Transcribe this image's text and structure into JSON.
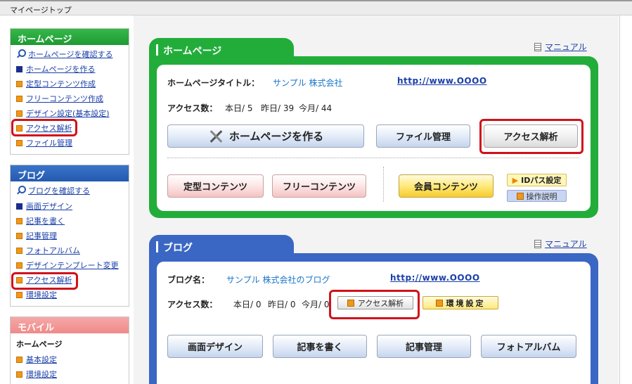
{
  "topbar": {
    "title": "マイページトップ"
  },
  "sidebar": {
    "homepage": {
      "title": "ホームページ",
      "items": [
        {
          "label": "ホームページを確認する",
          "icon": "magnifier-icon"
        },
        {
          "label": "ホームページを作る",
          "icon": "navy-square-icon"
        },
        {
          "label": "定型コンテンツ作成",
          "icon": "orange-square-icon"
        },
        {
          "label": "フリーコンテンツ作成",
          "icon": "orange-square-icon"
        },
        {
          "label": "デザイン設定(基本設定)",
          "icon": "orange-square-icon"
        },
        {
          "label": "アクセス解析",
          "icon": "orange-square-icon"
        },
        {
          "label": "ファイル管理",
          "icon": "orange-square-icon"
        }
      ]
    },
    "blog": {
      "title": "ブログ",
      "items": [
        {
          "label": "ブログを確認する",
          "icon": "magnifier-icon"
        },
        {
          "label": "画面デザイン",
          "icon": "navy-square-icon"
        },
        {
          "label": "記事を書く",
          "icon": "orange-square-icon"
        },
        {
          "label": "記事管理",
          "icon": "orange-square-icon"
        },
        {
          "label": "フォトアルバム",
          "icon": "orange-square-icon"
        },
        {
          "label": "デザインテンプレート変更",
          "icon": "orange-square-icon"
        },
        {
          "label": "アクセス解析",
          "icon": "orange-square-icon"
        },
        {
          "label": "環境設定",
          "icon": "orange-square-icon"
        }
      ]
    },
    "mobile": {
      "title": "モバイル",
      "subtitle": "ホームページ",
      "items": [
        {
          "label": "基本設定",
          "icon": "orange-square-icon"
        },
        {
          "label": "環境設定",
          "icon": "orange-square-icon"
        }
      ]
    }
  },
  "homepage_panel": {
    "tab": "ホームページ",
    "manual": "マニュアル",
    "title_label": "ホームページタイトル：",
    "title_value": "サンプル 株式会社",
    "url": "http://www.OOOO",
    "access_label": "アクセス数：",
    "access_today": "本日/ 5",
    "access_yesterday": "昨日/ 39",
    "access_month": "今月/ 44",
    "buttons": {
      "make": "ホームページを作る",
      "file": "ファイル管理",
      "access": "アクセス解析",
      "template": "定型コンテンツ",
      "free": "フリーコンテンツ",
      "member": "会員コンテンツ",
      "idpass": "IDパス設定",
      "howto": "操作説明"
    }
  },
  "blog_panel": {
    "tab": "ブログ",
    "manual": "マニュアル",
    "name_label": "ブログ名：",
    "name_value": "サンプル 株式会社のブログ",
    "url": "http://www.OOOO",
    "access_label": "アクセス数：",
    "access_today": "本日/ 0",
    "access_yesterday": "昨日/ 0",
    "access_month": "今月/ 0",
    "buttons": {
      "access": "アクセス解析",
      "env": "環境設定",
      "design": "画面デザイン",
      "write": "記事を書く",
      "manage": "記事管理",
      "album": "フォトアルバム"
    }
  },
  "colors": {
    "homepage": "#22ad3a",
    "blog": "#3a66c4",
    "mobile": "#ef8a8a",
    "highlight": "#d0121b"
  }
}
